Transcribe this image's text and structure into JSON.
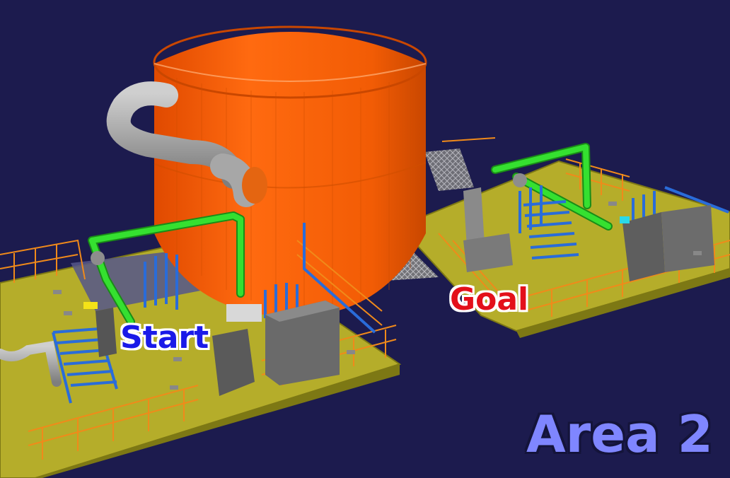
{
  "labels": {
    "start": "Start",
    "goal": "Goal",
    "area": "Area 2"
  },
  "colors": {
    "background": "#1c1b4e",
    "platform": "#b5ad2a",
    "tank": "#f25c05",
    "railing": "#f08a1a",
    "green_pipe": "#2ed42a",
    "blue_pipe": "#2a6cd9",
    "grey_pipe": "#a7a7a7",
    "start_text": "#1a1ae8",
    "goal_text": "#e3101a",
    "area_text": "#7f86ff"
  },
  "icons": [
    "tank-icon",
    "pipe-icon",
    "platform-icon",
    "railing-icon"
  ]
}
